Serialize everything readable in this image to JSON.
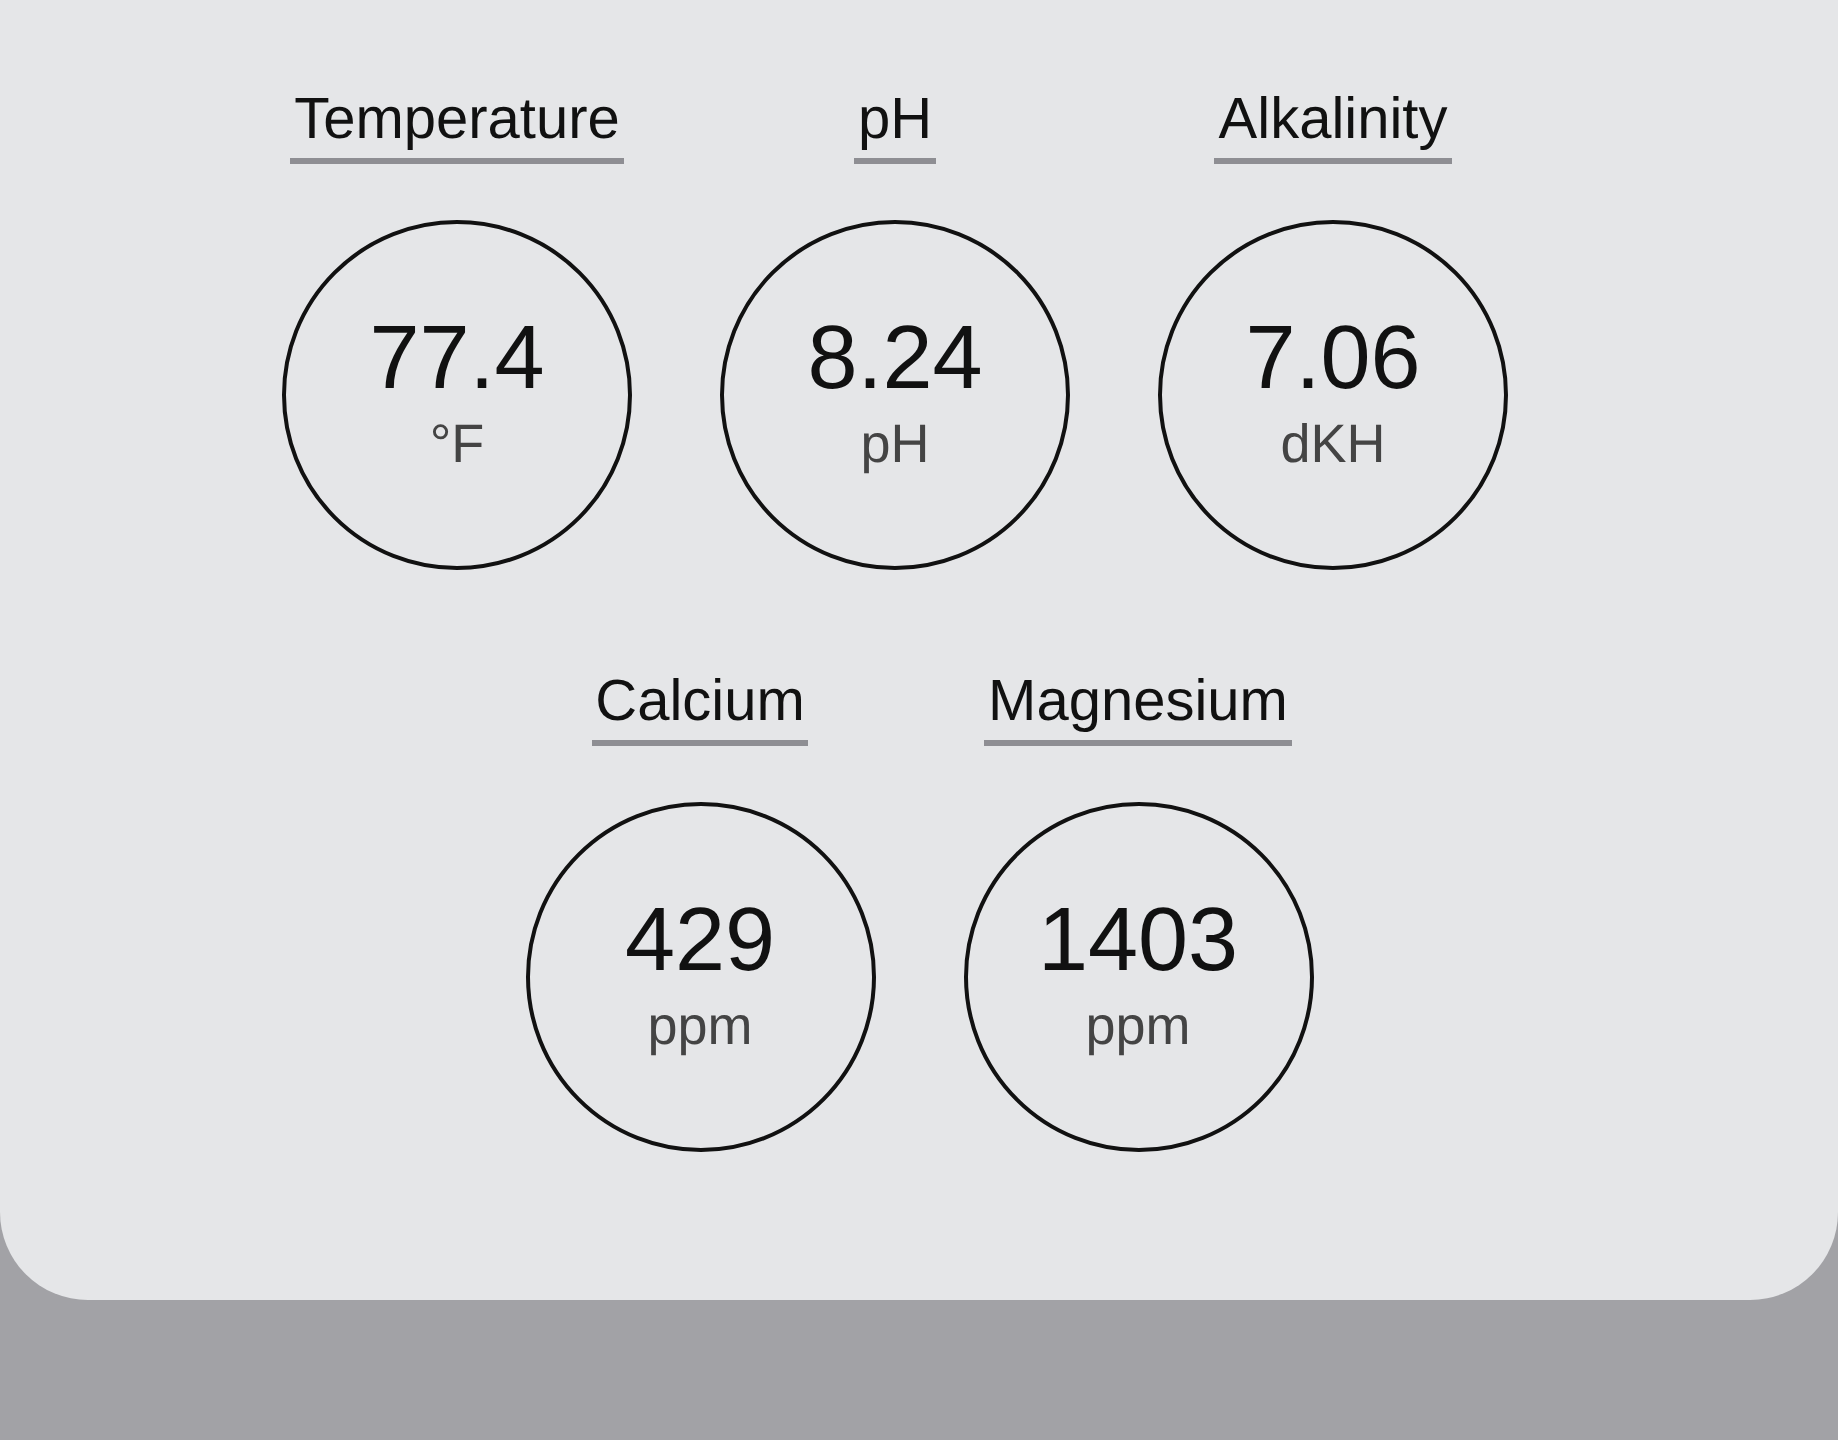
{
  "rows": [
    [
      {
        "label": "Temperature",
        "value": "77.4",
        "unit": "°F"
      },
      {
        "label": "pH",
        "value": "8.24",
        "unit": "pH"
      },
      {
        "label": "Alkalinity",
        "value": "7.06",
        "unit": "dKH"
      }
    ],
    [
      {
        "label": "Calcium",
        "value": "429",
        "unit": "ppm"
      },
      {
        "label": "Magnesium",
        "value": "1403",
        "unit": "ppm"
      }
    ]
  ]
}
